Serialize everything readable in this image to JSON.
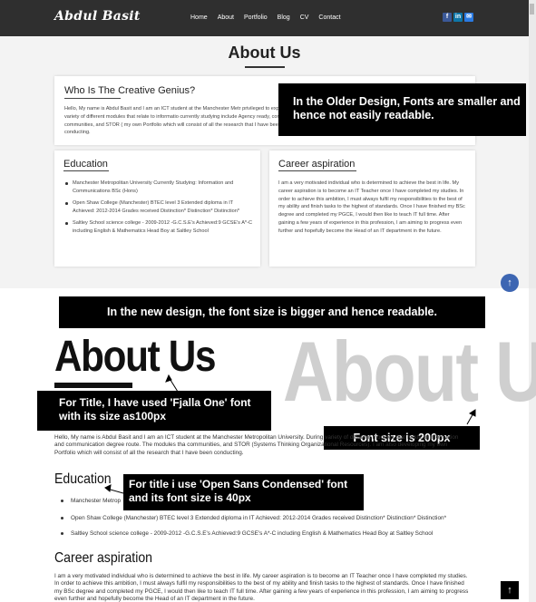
{
  "old_design": {
    "logo": "Abdul Basit",
    "nav": [
      "Home",
      "About",
      "Portfolio",
      "Blog",
      "CV",
      "Contact"
    ],
    "social": [
      "f",
      "in",
      "✉"
    ],
    "page_title": "About Us",
    "intro_card": {
      "heading": "Who Is The Creative Genius?",
      "text": "Hello, My name is Abdul Basit and I am an ICT student at the Manchester Metr privileged to experience a variety of different modules that relate to informatio currently studying include Agency ready, connected communities, and STOR ( my own Portfolio which will consist of all the research that I have been conducting."
    },
    "education_card": {
      "heading": "Education",
      "items": [
        "Manchester Metropolitan University Currently Studying: Information and Communications BSc (Hons)",
        "Open Shaw College (Manchester) BTEC level 3 Extended diploma in IT Achieved: 2012-2014 Grades received Distinction* Distinction* Distinction*",
        "Saltley School science college - 2009-2012 -G.C.S.E's Achieved:9 GCSE's A*-C including English & Mathematics Head Boy at Saltley School"
      ]
    },
    "career_card": {
      "heading": "Career aspiration",
      "text": "I am a very motivated individual who is determined to achieve the best in life. My career aspiration is to become an IT Teacher once I have completed my studies. In order to achieve this ambition, I must always fulfil my responsibilities to the best of my ability and finish tasks to the highest of standards. Once I have finished my BSc degree and completed my PGCE, I would then like to teach IT full time. After gaining a few years of experience in this profession, I am aiming to progress even further and hopefully become the Head of an IT department in the future."
    }
  },
  "annotations": {
    "old_note": "In the Older Design, Fonts are smaller and hence not easily readable.",
    "new_note": "In the new design, the font size is bigger and hence readable.",
    "title_note": "For Title, I have used 'Fjalla One' font with its size as100px",
    "size_note": "Font size is 200px",
    "heading_note": "For title i use 'Open Sans Condensed' font and its font size is 40px"
  },
  "new_design": {
    "title": "About Us",
    "ghost_title": "About Us",
    "intro_text": "Hello, My name is Abdul Basit and I am an ICT student at the Manchester Metropolitan University. During variety of different modules that relate to information and communication degree route. The modules tha communities, and STOR (Systems Thinking Organizational Resources). I am also developing my own Portfolio which will consist of all the research that I have been conducting.",
    "education_heading": "Education",
    "education_items": [
      "Manchester Metrop",
      "Open Shaw College (Manchester) BTEC level 3 Extended diploma in IT Achieved: 2012-2014 Grades received Distinction* Distinction* Distinction*",
      "Saltley School science college - 2009-2012 -G.C.S.E's Achieved:9 GCSE's A*-C including English & Mathematics Head Boy at Saltley School"
    ],
    "career_heading": "Career aspiration",
    "career_text": "I am a very motivated individual who is determined to achieve the best in life. My career aspiration is to become an IT Teacher once I have completed my studies. In order to achieve this ambition, I must always fulfil my responsibilities to the best of my ability and finish tasks to the highest of standards. Once I have finished my BSc degree and completed my PGCE, I would then like to teach IT full time. After gaining a few years of experience in this profession, I am aiming to progress even further and hopefully become the Head of an IT department in the future."
  },
  "icons": {
    "scroll_top": "↑"
  }
}
